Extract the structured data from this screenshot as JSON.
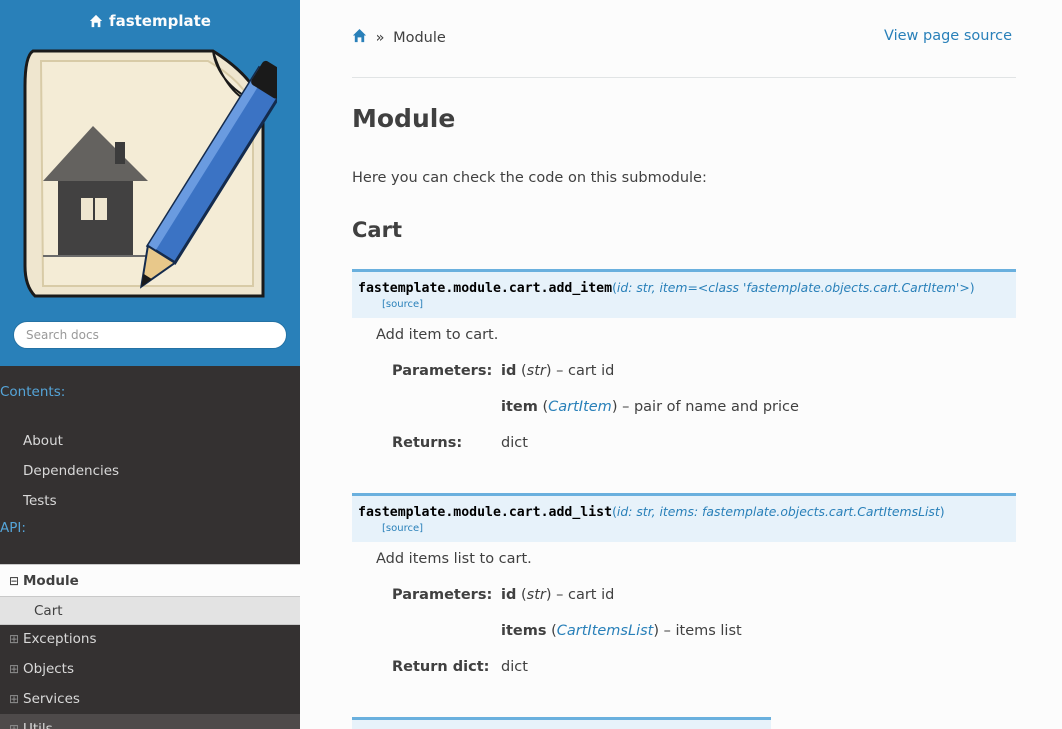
{
  "sidebar": {
    "brand": "fastemplate",
    "search_placeholder": "Search docs",
    "contents_caption": "Contents:",
    "contents_items": [
      "About",
      "Dependencies",
      "Tests"
    ],
    "api_caption": "API:",
    "current": "Module",
    "current_sub": "Cart",
    "api_items": [
      "Exceptions",
      "Objects",
      "Services",
      "Utils"
    ]
  },
  "breadcrumb": {
    "separator": "»",
    "current": "Module",
    "view_source": "View page source"
  },
  "page": {
    "title": "Module",
    "intro": "Here you can check the code on this submodule:",
    "section": "Cart"
  },
  "functions": [
    {
      "name": "fastemplate.module.cart.add_item",
      "params": "id: str, item=<class 'fastemplate.objects.cart.CartItem'>",
      "source": "[source]",
      "description": "Add item to cart.",
      "params_label": "Parameters:",
      "p1_name": "id",
      "p1_type": "str",
      "p1_desc": " – cart id",
      "p2_name": "item",
      "p2_type": "CartItem",
      "p2_desc": " – pair of name and price",
      "returns_label": "Returns:",
      "returns": "dict"
    },
    {
      "name": "fastemplate.module.cart.add_list",
      "params": "id: str, items: fastemplate.objects.cart.CartItemsList",
      "source": "[source]",
      "description": "Add items list to cart.",
      "params_label": "Parameters:",
      "p1_name": "id",
      "p1_type": "str",
      "p1_desc": " – cart id",
      "p2_name": "items",
      "p2_type": "CartItemsList",
      "p2_desc": " – items list",
      "returns_label": "Return dict:",
      "returns": "dict"
    }
  ],
  "colors": {
    "sidebar_bg": "#343131",
    "sidebar_top": "#2980b9",
    "link": "#2980b9",
    "sig_bg": "#e7f2fa",
    "sig_border": "#6ab0de"
  }
}
